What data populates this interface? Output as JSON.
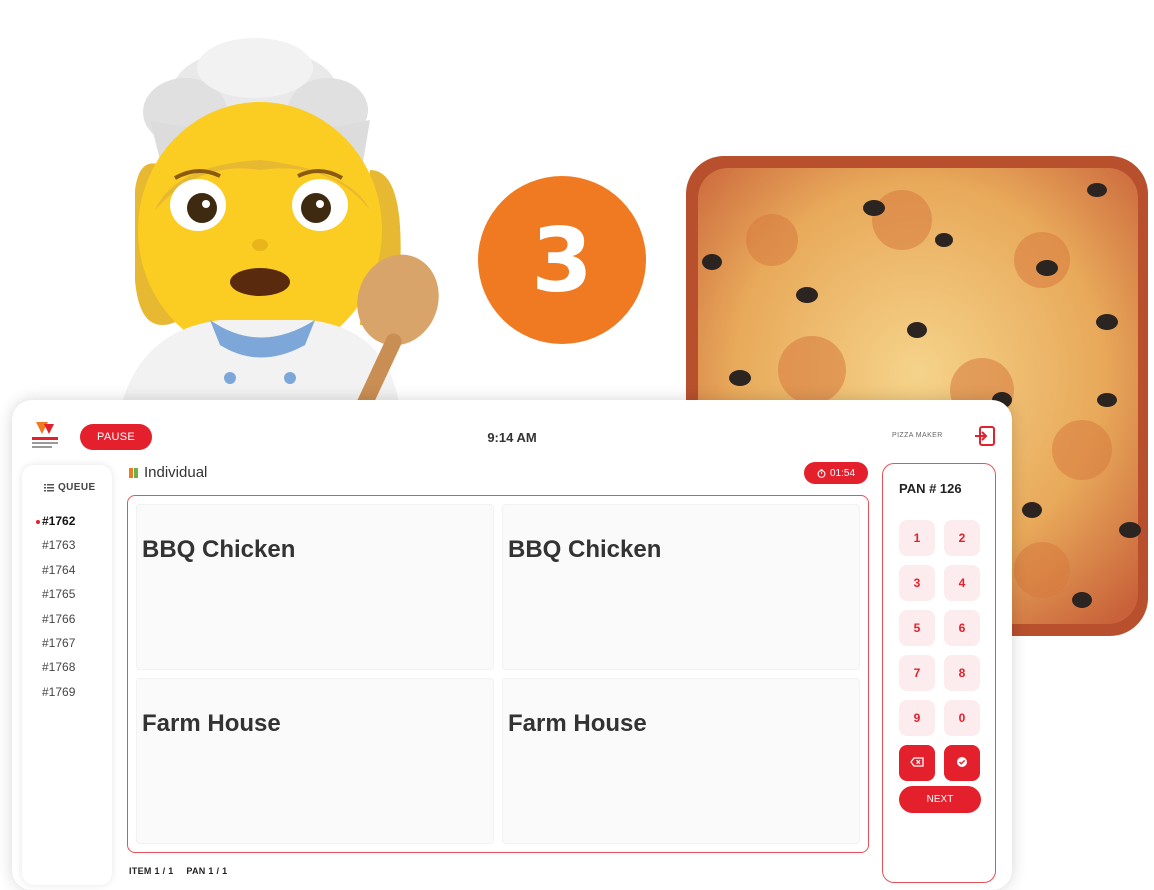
{
  "hero": {
    "step_number": "3"
  },
  "topbar": {
    "pause_label": "PAUSE",
    "time": "9:14 AM",
    "user_role": "PIZZA MAKER",
    "logout_icon": "logout-icon"
  },
  "queue": {
    "title": "QUEUE",
    "items": [
      "#1762",
      "#1763",
      "#1764",
      "#1765",
      "#1766",
      "#1767",
      "#1768",
      "#1769"
    ],
    "active_index": 0
  },
  "content": {
    "section_label": "Individual",
    "timer": "01:54",
    "cells": [
      "BBQ Chicken",
      "BBQ Chicken",
      "Farm House",
      "Farm House"
    ],
    "item_counter": "ITEM 1 / 1",
    "pan_counter": "PAN 1 / 1"
  },
  "keypad": {
    "pan_label": "PAN # 126",
    "keys": [
      "1",
      "2",
      "3",
      "4",
      "5",
      "6",
      "7",
      "8",
      "9",
      "0"
    ],
    "next_label": "NEXT"
  },
  "colors": {
    "accent": "#e3202c",
    "accent_soft": "#fdecee",
    "step_circle": "#f07a22"
  }
}
